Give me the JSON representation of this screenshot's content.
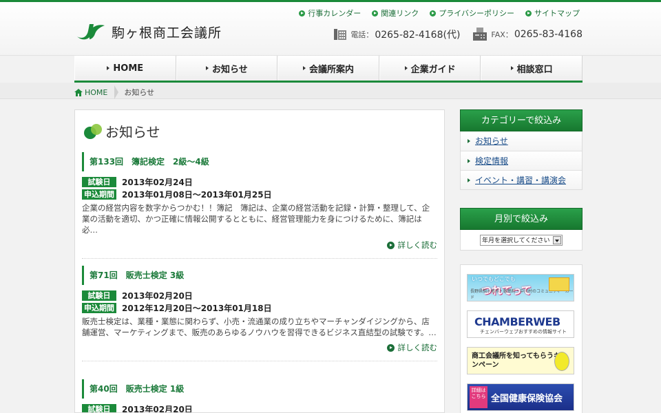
{
  "header": {
    "site_name": "駒ヶ根商工会議所",
    "util_links": [
      "行事カレンダー",
      "関連リンク",
      "プライバシーポリシー",
      "サイトマップ"
    ],
    "tel_label": "電話：",
    "tel": "0265-82-4168(代)",
    "fax_label": "FAX：",
    "fax": "0265-83-4168"
  },
  "nav": [
    "HOME",
    "お知らせ",
    "会議所案内",
    "企業ガイド",
    "相談窓口"
  ],
  "breadcrumb": {
    "home": "HOME",
    "current": "お知らせ"
  },
  "main": {
    "title": "お知らせ",
    "more_label": "詳しく読む",
    "posts": [
      {
        "title": "第133回　簿記検定　2級～4級",
        "exam_label": "試験日",
        "exam_date": "2013年02月24日",
        "apply_label": "申込期間",
        "apply_period": "2013年01月08日～2013年01月25日",
        "excerpt": "企業の経営内容を数字からつかむ！！簿記　簿記は、企業の経営活動を記録・計算・整理して、企業の活動を適切、かつ正確に情報公開するとともに、経営管理能力を身につけるために、簿記は必…"
      },
      {
        "title": "第71回　販売士検定 3級",
        "exam_label": "試験日",
        "exam_date": "2013年02月20日",
        "apply_label": "申込期間",
        "apply_period": "2012年12月20日～2013年01月18日",
        "excerpt": "販売士検定は、業種・業態に関わらず、小売・流通業の成り立ちやマーチャンダイジングから、店舗運営、マーケティングまで、販売のあらゆるノウハウを習得できるビジネス直結型の試験です。…"
      },
      {
        "title": "第40回　販売士検定 1級",
        "exam_label": "試験日",
        "exam_date": "2013年02月20日"
      }
    ]
  },
  "sidebar": {
    "category_title": "カテゴリーで絞込み",
    "categories": [
      "お知らせ",
      "検定情報",
      "イベント・講習・講演会"
    ],
    "month_title": "月別で絞込み",
    "month_select": "年月を選択してください",
    "banners": [
      {
        "top": "いつでもどこでも",
        "main": "つれてって",
        "sub": "長野県駒ヶ根市・飯島町・中川村のコミュニティーカード"
      },
      {
        "main": "CHAMBERWEB",
        "sub": "チェンバーウェブおすすめの情報サイト"
      },
      {
        "main": "商工会議所を知ってもらうキャンペーン"
      },
      {
        "tag": "詳細はこちら",
        "main": "全国健康保険協会"
      }
    ]
  },
  "colors": {
    "brand_green": "#1b8a3a",
    "link_blue": "#1b4e8a"
  }
}
